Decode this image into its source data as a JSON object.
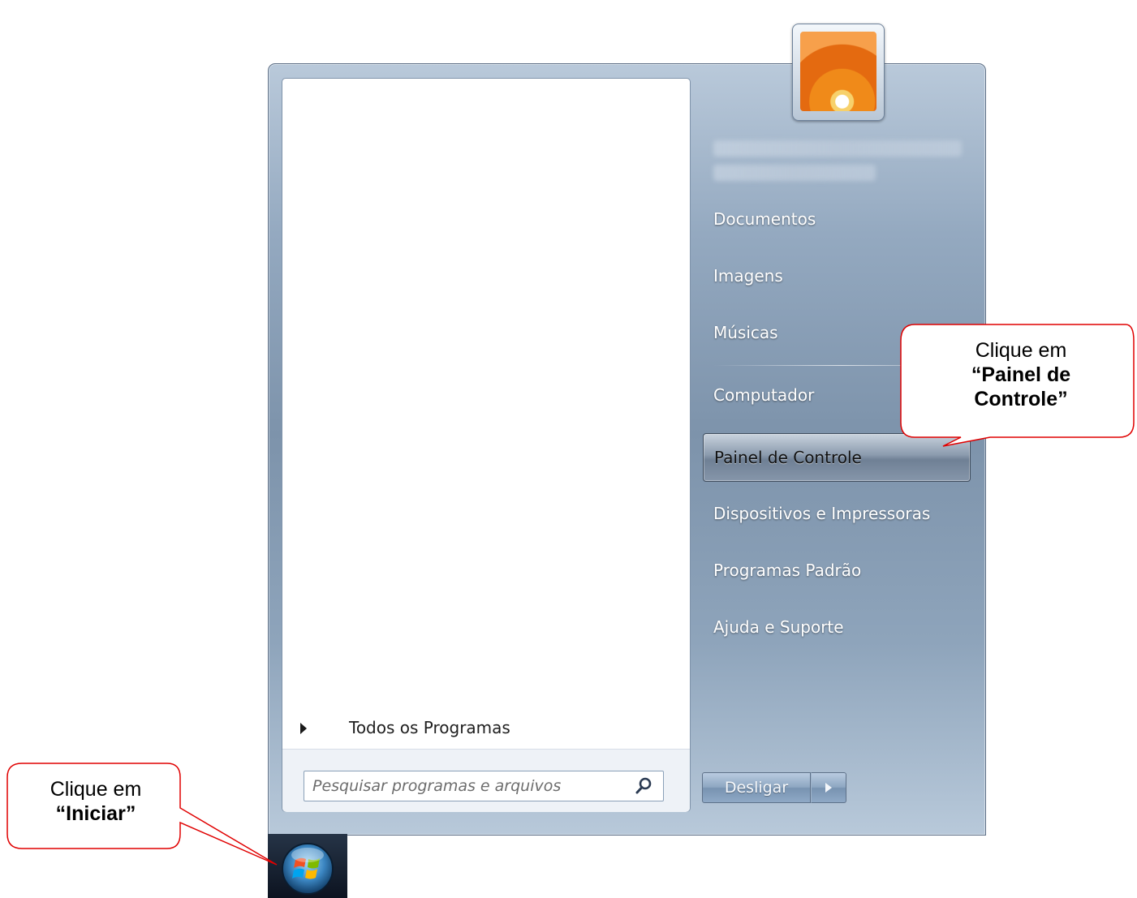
{
  "start_menu": {
    "all_programs_label": "Todos os Programas",
    "search_placeholder": "Pesquisar programas e arquivos",
    "right_items": [
      {
        "label": "Documentos"
      },
      {
        "label": "Imagens"
      },
      {
        "label": "Músicas"
      },
      {
        "label": "Computador"
      },
      {
        "label": "Painel de Controle",
        "selected": true
      },
      {
        "label": "Dispositivos e Impressoras"
      },
      {
        "label": "Programas Padrão"
      },
      {
        "label": "Ajuda e Suporte"
      }
    ],
    "shutdown_label": "Desligar"
  },
  "callouts": {
    "painel": {
      "line1": "Clique em",
      "line2": "“Painel de",
      "line3": "Controle”"
    },
    "iniciar": {
      "line1": "Clique em",
      "line2": "“Iniciar”"
    }
  },
  "colors": {
    "callout_border": "#e00000",
    "menu_accent": "#8aa0b8"
  }
}
